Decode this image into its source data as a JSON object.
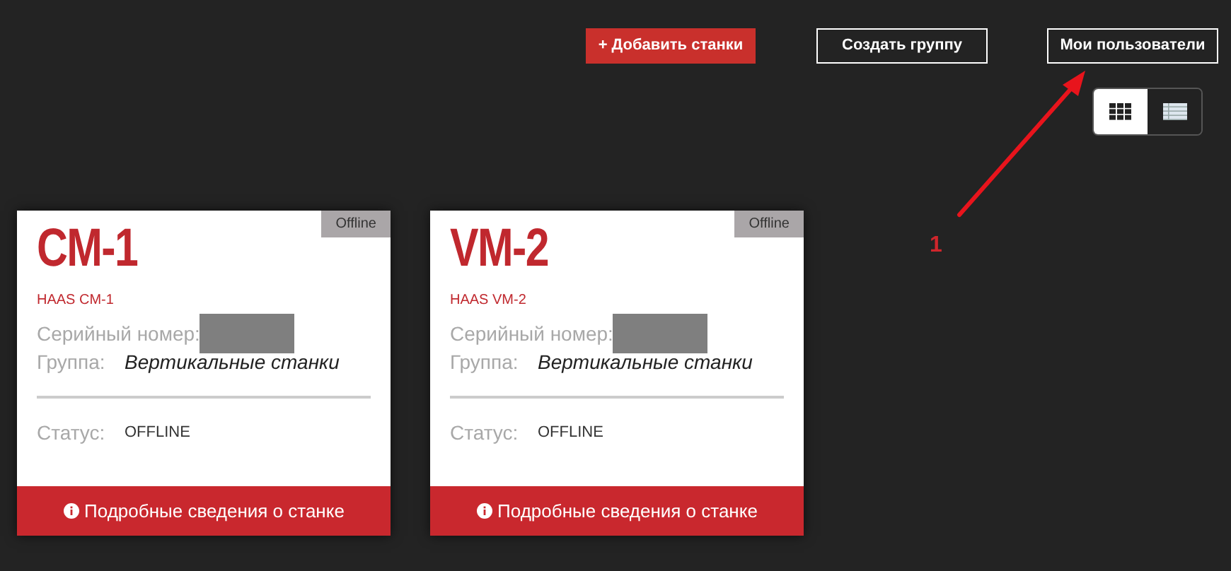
{
  "actions": [
    {
      "label": "+ Добавить станки",
      "kind": "primary"
    },
    {
      "label": "Создать группу",
      "kind": "outline"
    },
    {
      "label": "Мои пользователи",
      "kind": "outline"
    }
  ],
  "view_toggle": [
    {
      "kind": "grid",
      "selected": true
    },
    {
      "kind": "list",
      "selected": false
    }
  ],
  "machines": [
    {
      "name": "CM-1",
      "badge": "Offline",
      "model": "HAAS CM-1",
      "serial_label": "Серийный номер:",
      "group_label": "Группа:",
      "group": "Вертикальные станки",
      "status_label": "Статус:",
      "status": "OFFLINE",
      "details": "Подробные сведения о станке"
    },
    {
      "name": "VM-2",
      "badge": "Offline",
      "model": "HAAS VM-2",
      "serial_label": "Серийный номер:",
      "group_label": "Группа:",
      "group": "Вертикальные станки",
      "status_label": "Статус:",
      "status": "OFFLINE",
      "details": "Подробные сведения о станке"
    }
  ],
  "annotation": {
    "label": "1"
  }
}
